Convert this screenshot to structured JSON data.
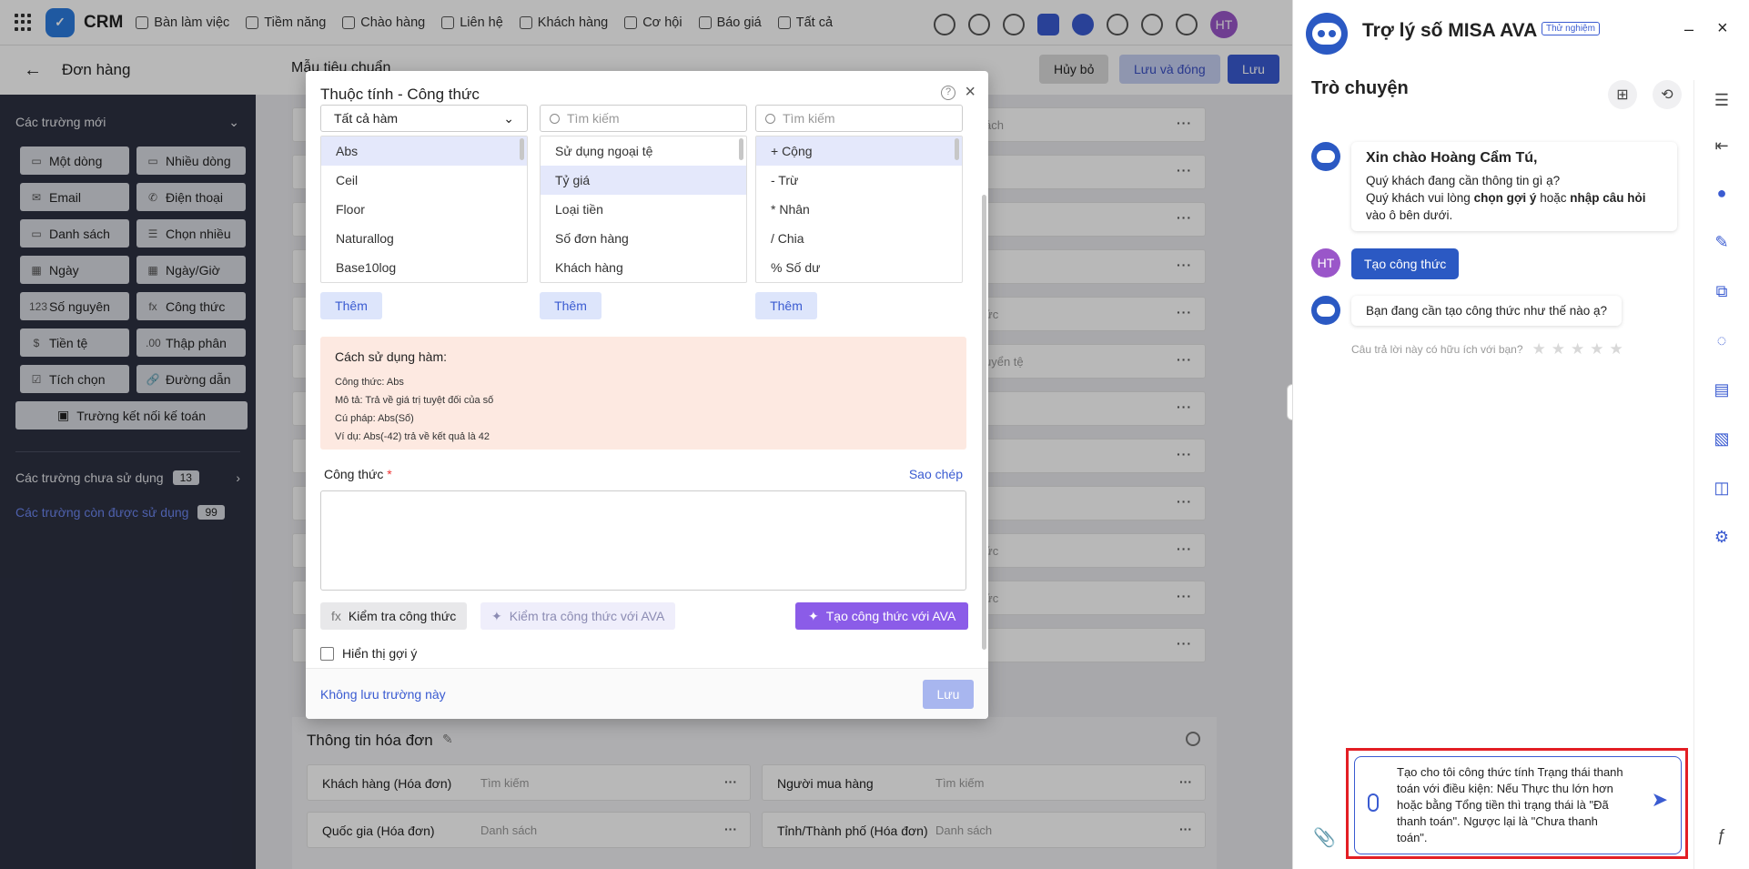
{
  "app": {
    "brand": "CRM",
    "avatar": "HT"
  },
  "nav": [
    "Bàn làm việc",
    "Tiềm năng",
    "Chào hàng",
    "Liên hệ",
    "Khách hàng",
    "Cơ hội",
    "Báo giá",
    "Tất cả"
  ],
  "subbar": {
    "title": "Đơn hàng",
    "template": "Mẫu tiêu chuẩn",
    "cancel": "Hủy bỏ",
    "save_close": "Lưu và đóng",
    "save": "Lưu"
  },
  "sidebar": {
    "new_fields": "Các trường mới",
    "fields": [
      {
        "label": "Một dòng",
        "icon": "▭"
      },
      {
        "label": "Nhiều dòng",
        "icon": "▭"
      },
      {
        "label": "Email",
        "icon": "✉"
      },
      {
        "label": "Điện thoại",
        "icon": "✆"
      },
      {
        "label": "Danh sách",
        "icon": "▭"
      },
      {
        "label": "Chọn nhiều",
        "icon": "☰"
      },
      {
        "label": "Ngày",
        "icon": "▦"
      },
      {
        "label": "Ngày/Giờ",
        "icon": "▦"
      },
      {
        "label": "Số nguyên",
        "icon": "123"
      },
      {
        "label": "Công thức",
        "icon": "fx"
      },
      {
        "label": "Tiền tệ",
        "icon": "$"
      },
      {
        "label": "Thập phân",
        "icon": ".00"
      },
      {
        "label": "Tích chọn",
        "icon": "☑"
      },
      {
        "label": "Đường dẫn",
        "icon": "🔗"
      }
    ],
    "accounting": "Trường kết nối kế toán",
    "unused": "Các trường chưa sử dụng",
    "unused_count": "13",
    "in_use": "Các trường còn được sử dụng",
    "in_use_count": "99"
  },
  "bg_rows": [
    "ách",
    "",
    "",
    "",
    "ức",
    "uyển tệ",
    "",
    "",
    "",
    "ức",
    "ức",
    ""
  ],
  "invoice": {
    "title": "Thông tin hóa đơn",
    "fields": [
      {
        "label": "Khách hàng (Hóa đơn)",
        "placeholder": "Tìm kiếm"
      },
      {
        "label": "Người mua hàng",
        "placeholder": "Tìm kiếm"
      },
      {
        "label": "Quốc gia (Hóa đơn)",
        "placeholder": "Danh sách"
      },
      {
        "label": "Tỉnh/Thành phố (Hóa đơn)",
        "placeholder": "Danh sách"
      }
    ]
  },
  "modal": {
    "title": "Thuộc tính - Công thức",
    "func_filter": "Tất cả hàm",
    "search_placeholder": "Tìm kiếm",
    "functions": [
      "Abs",
      "Ceil",
      "Floor",
      "Naturallog",
      "Base10log"
    ],
    "fields": [
      "Sử dụng ngoại tệ",
      "Tỷ giá",
      "Loại tiền",
      "Số đơn hàng",
      "Khách hàng"
    ],
    "operators": [
      "+ Cộng",
      "- Trừ",
      "* Nhân",
      "/ Chia",
      "% Số dư"
    ],
    "add": "Thêm",
    "usage_title": "Cách sử dụng hàm:",
    "usage_lines": [
      "Công thức: Abs",
      "Mô tả: Trả về giá trị tuyệt đối của số",
      "Cú pháp: Abs(Số)",
      "Ví dụ: Abs(-42) trả về kết quả là 42"
    ],
    "formula_label": "Công thức",
    "required": "*",
    "copy": "Sao chép",
    "check": "Kiểm tra công thức",
    "check_ava": "Kiểm tra công thức với AVA",
    "generate": "Tạo công thức với AVA",
    "hint": "Hiển thị gợi ý",
    "no_save": "Không lưu trường này",
    "save": "Lưu"
  },
  "assistant": {
    "title": "Trợ lý số MISA AVA",
    "beta": "Thử nghiệm",
    "chat_title": "Trò chuyện",
    "greeting": "Xin chào Hoàng Cẩm Tú,",
    "g1": "Quý khách đang cần thông tin gì ạ?",
    "g2a": "Quý khách vui lòng ",
    "g2b": "chọn gợi ý",
    "g2c": " hoặc ",
    "g2d": "nhập câu hỏi",
    "g3": "vào ô bên dưới.",
    "user_avatar": "HT",
    "user_msg": "Tạo công thức",
    "bot_reply": "Bạn đang cần tạo công thức như thế nào ạ?",
    "rating_q": "Câu trả lời này có hữu ích với bạn?",
    "stars": "★★★★★",
    "input": "Tạo cho tôi công thức tính Trạng thái thanh toán với điều kiện: Nếu Thực thu lớn hơn hoặc bằng Tổng tiền thì trạng thái là \"Đã thanh toán\". Ngược lại là \"Chưa thanh toán\"."
  }
}
